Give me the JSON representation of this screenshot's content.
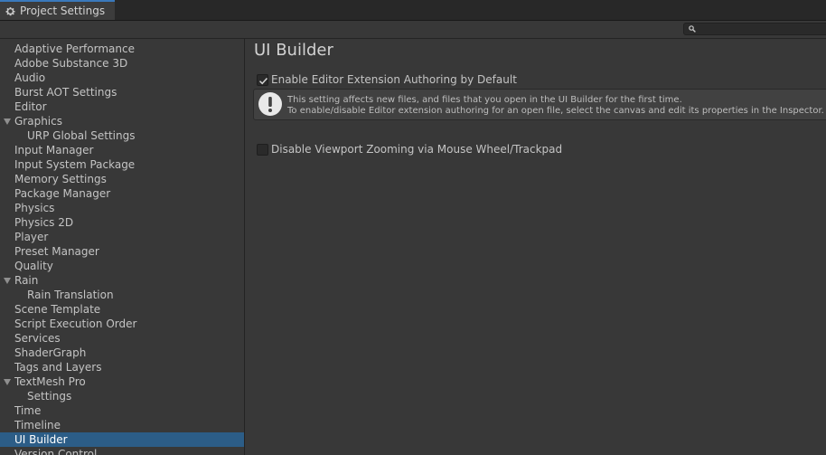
{
  "window": {
    "tab_title": "Project Settings"
  },
  "search": {
    "placeholder": ""
  },
  "sidebar": {
    "items": [
      {
        "label": "Adaptive Performance",
        "level": 0,
        "expandable": false,
        "selected": false
      },
      {
        "label": "Adobe Substance 3D",
        "level": 0,
        "expandable": false,
        "selected": false
      },
      {
        "label": "Audio",
        "level": 0,
        "expandable": false,
        "selected": false
      },
      {
        "label": "Burst AOT Settings",
        "level": 0,
        "expandable": false,
        "selected": false
      },
      {
        "label": "Editor",
        "level": 0,
        "expandable": false,
        "selected": false
      },
      {
        "label": "Graphics",
        "level": 0,
        "expandable": true,
        "selected": false
      },
      {
        "label": "URP Global Settings",
        "level": 1,
        "expandable": false,
        "selected": false
      },
      {
        "label": "Input Manager",
        "level": 0,
        "expandable": false,
        "selected": false
      },
      {
        "label": "Input System Package",
        "level": 0,
        "expandable": false,
        "selected": false
      },
      {
        "label": "Memory Settings",
        "level": 0,
        "expandable": false,
        "selected": false
      },
      {
        "label": "Package Manager",
        "level": 0,
        "expandable": false,
        "selected": false
      },
      {
        "label": "Physics",
        "level": 0,
        "expandable": false,
        "selected": false
      },
      {
        "label": "Physics 2D",
        "level": 0,
        "expandable": false,
        "selected": false
      },
      {
        "label": "Player",
        "level": 0,
        "expandable": false,
        "selected": false
      },
      {
        "label": "Preset Manager",
        "level": 0,
        "expandable": false,
        "selected": false
      },
      {
        "label": "Quality",
        "level": 0,
        "expandable": false,
        "selected": false
      },
      {
        "label": "Rain",
        "level": 0,
        "expandable": true,
        "selected": false
      },
      {
        "label": "Rain Translation",
        "level": 1,
        "expandable": false,
        "selected": false
      },
      {
        "label": "Scene Template",
        "level": 0,
        "expandable": false,
        "selected": false
      },
      {
        "label": "Script Execution Order",
        "level": 0,
        "expandable": false,
        "selected": false
      },
      {
        "label": "Services",
        "level": 0,
        "expandable": false,
        "selected": false
      },
      {
        "label": "ShaderGraph",
        "level": 0,
        "expandable": false,
        "selected": false
      },
      {
        "label": "Tags and Layers",
        "level": 0,
        "expandable": false,
        "selected": false
      },
      {
        "label": "TextMesh Pro",
        "level": 0,
        "expandable": true,
        "selected": false
      },
      {
        "label": "Settings",
        "level": 1,
        "expandable": false,
        "selected": false
      },
      {
        "label": "Time",
        "level": 0,
        "expandable": false,
        "selected": false
      },
      {
        "label": "Timeline",
        "level": 0,
        "expandable": false,
        "selected": false
      },
      {
        "label": "UI Builder",
        "level": 0,
        "expandable": false,
        "selected": true
      },
      {
        "label": "Version Control",
        "level": 0,
        "expandable": false,
        "selected": false
      }
    ]
  },
  "main": {
    "title": "UI Builder",
    "enable_authoring": {
      "label": "Enable Editor Extension Authoring by Default",
      "checked": true
    },
    "help": {
      "icon": "warning-icon",
      "line1": "This setting affects new files, and files that you open in the UI Builder for the first time.",
      "line2": "To enable/disable Editor extension authoring for an open file, select the canvas and edit its properties in the Inspector."
    },
    "disable_zoom": {
      "label": "Disable Viewport Zooming via Mouse Wheel/Trackpad",
      "checked": false
    }
  },
  "colors": {
    "background": "#383838",
    "selection": "#2c5d87",
    "tab_accent": "#3a79bb"
  }
}
